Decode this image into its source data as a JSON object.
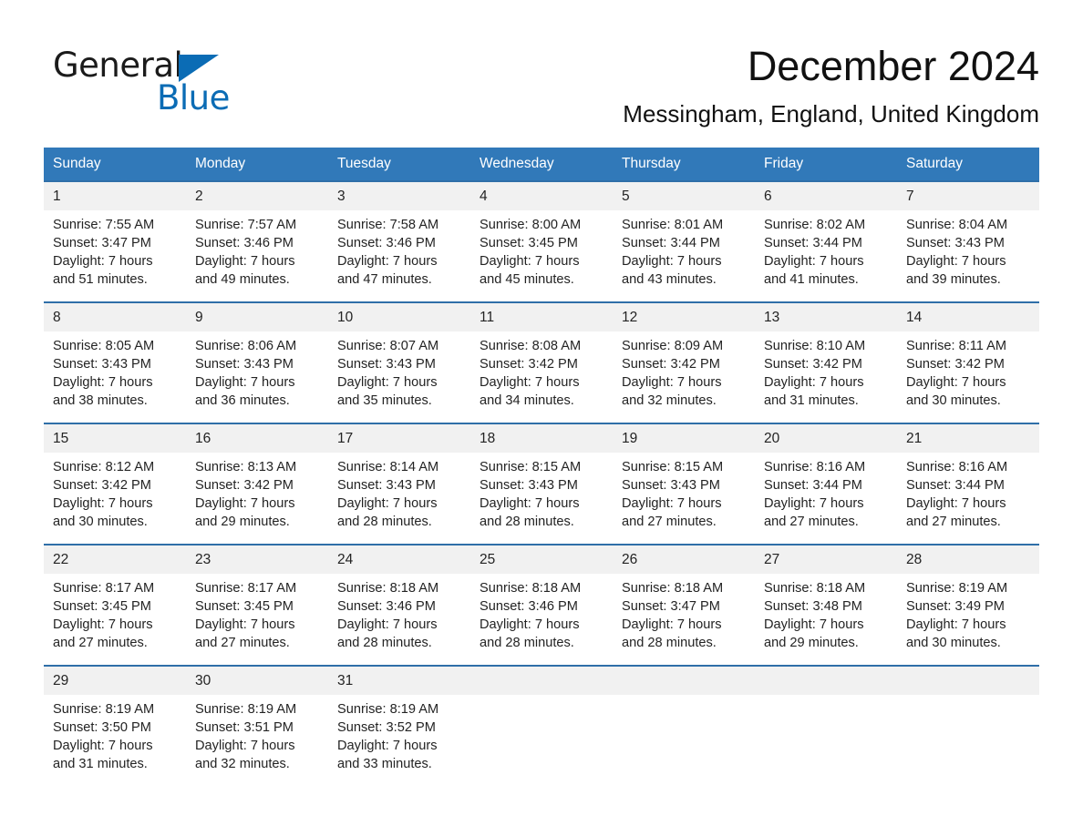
{
  "brand": {
    "name_part1": "General",
    "name_part2": "Blue",
    "triangle_color": "#0b6cb5"
  },
  "header": {
    "title": "December 2024",
    "subtitle": "Messingham, England, United Kingdom"
  },
  "theme": {
    "header_blue": "#3179b9",
    "row_divider_blue": "#2f6fa8",
    "daynum_band": "#f1f1f1",
    "text": "#232323"
  },
  "weekdays": [
    "Sunday",
    "Monday",
    "Tuesday",
    "Wednesday",
    "Thursday",
    "Friday",
    "Saturday"
  ],
  "weeks": [
    [
      {
        "day": "1",
        "l1": "Sunrise: 7:55 AM",
        "l2": "Sunset: 3:47 PM",
        "l3": "Daylight: 7 hours",
        "l4": "and 51 minutes."
      },
      {
        "day": "2",
        "l1": "Sunrise: 7:57 AM",
        "l2": "Sunset: 3:46 PM",
        "l3": "Daylight: 7 hours",
        "l4": "and 49 minutes."
      },
      {
        "day": "3",
        "l1": "Sunrise: 7:58 AM",
        "l2": "Sunset: 3:46 PM",
        "l3": "Daylight: 7 hours",
        "l4": "and 47 minutes."
      },
      {
        "day": "4",
        "l1": "Sunrise: 8:00 AM",
        "l2": "Sunset: 3:45 PM",
        "l3": "Daylight: 7 hours",
        "l4": "and 45 minutes."
      },
      {
        "day": "5",
        "l1": "Sunrise: 8:01 AM",
        "l2": "Sunset: 3:44 PM",
        "l3": "Daylight: 7 hours",
        "l4": "and 43 minutes."
      },
      {
        "day": "6",
        "l1": "Sunrise: 8:02 AM",
        "l2": "Sunset: 3:44 PM",
        "l3": "Daylight: 7 hours",
        "l4": "and 41 minutes."
      },
      {
        "day": "7",
        "l1": "Sunrise: 8:04 AM",
        "l2": "Sunset: 3:43 PM",
        "l3": "Daylight: 7 hours",
        "l4": "and 39 minutes."
      }
    ],
    [
      {
        "day": "8",
        "l1": "Sunrise: 8:05 AM",
        "l2": "Sunset: 3:43 PM",
        "l3": "Daylight: 7 hours",
        "l4": "and 38 minutes."
      },
      {
        "day": "9",
        "l1": "Sunrise: 8:06 AM",
        "l2": "Sunset: 3:43 PM",
        "l3": "Daylight: 7 hours",
        "l4": "and 36 minutes."
      },
      {
        "day": "10",
        "l1": "Sunrise: 8:07 AM",
        "l2": "Sunset: 3:43 PM",
        "l3": "Daylight: 7 hours",
        "l4": "and 35 minutes."
      },
      {
        "day": "11",
        "l1": "Sunrise: 8:08 AM",
        "l2": "Sunset: 3:42 PM",
        "l3": "Daylight: 7 hours",
        "l4": "and 34 minutes."
      },
      {
        "day": "12",
        "l1": "Sunrise: 8:09 AM",
        "l2": "Sunset: 3:42 PM",
        "l3": "Daylight: 7 hours",
        "l4": "and 32 minutes."
      },
      {
        "day": "13",
        "l1": "Sunrise: 8:10 AM",
        "l2": "Sunset: 3:42 PM",
        "l3": "Daylight: 7 hours",
        "l4": "and 31 minutes."
      },
      {
        "day": "14",
        "l1": "Sunrise: 8:11 AM",
        "l2": "Sunset: 3:42 PM",
        "l3": "Daylight: 7 hours",
        "l4": "and 30 minutes."
      }
    ],
    [
      {
        "day": "15",
        "l1": "Sunrise: 8:12 AM",
        "l2": "Sunset: 3:42 PM",
        "l3": "Daylight: 7 hours",
        "l4": "and 30 minutes."
      },
      {
        "day": "16",
        "l1": "Sunrise: 8:13 AM",
        "l2": "Sunset: 3:42 PM",
        "l3": "Daylight: 7 hours",
        "l4": "and 29 minutes."
      },
      {
        "day": "17",
        "l1": "Sunrise: 8:14 AM",
        "l2": "Sunset: 3:43 PM",
        "l3": "Daylight: 7 hours",
        "l4": "and 28 minutes."
      },
      {
        "day": "18",
        "l1": "Sunrise: 8:15 AM",
        "l2": "Sunset: 3:43 PM",
        "l3": "Daylight: 7 hours",
        "l4": "and 28 minutes."
      },
      {
        "day": "19",
        "l1": "Sunrise: 8:15 AM",
        "l2": "Sunset: 3:43 PM",
        "l3": "Daylight: 7 hours",
        "l4": "and 27 minutes."
      },
      {
        "day": "20",
        "l1": "Sunrise: 8:16 AM",
        "l2": "Sunset: 3:44 PM",
        "l3": "Daylight: 7 hours",
        "l4": "and 27 minutes."
      },
      {
        "day": "21",
        "l1": "Sunrise: 8:16 AM",
        "l2": "Sunset: 3:44 PM",
        "l3": "Daylight: 7 hours",
        "l4": "and 27 minutes."
      }
    ],
    [
      {
        "day": "22",
        "l1": "Sunrise: 8:17 AM",
        "l2": "Sunset: 3:45 PM",
        "l3": "Daylight: 7 hours",
        "l4": "and 27 minutes."
      },
      {
        "day": "23",
        "l1": "Sunrise: 8:17 AM",
        "l2": "Sunset: 3:45 PM",
        "l3": "Daylight: 7 hours",
        "l4": "and 27 minutes."
      },
      {
        "day": "24",
        "l1": "Sunrise: 8:18 AM",
        "l2": "Sunset: 3:46 PM",
        "l3": "Daylight: 7 hours",
        "l4": "and 28 minutes."
      },
      {
        "day": "25",
        "l1": "Sunrise: 8:18 AM",
        "l2": "Sunset: 3:46 PM",
        "l3": "Daylight: 7 hours",
        "l4": "and 28 minutes."
      },
      {
        "day": "26",
        "l1": "Sunrise: 8:18 AM",
        "l2": "Sunset: 3:47 PM",
        "l3": "Daylight: 7 hours",
        "l4": "and 28 minutes."
      },
      {
        "day": "27",
        "l1": "Sunrise: 8:18 AM",
        "l2": "Sunset: 3:48 PM",
        "l3": "Daylight: 7 hours",
        "l4": "and 29 minutes."
      },
      {
        "day": "28",
        "l1": "Sunrise: 8:19 AM",
        "l2": "Sunset: 3:49 PM",
        "l3": "Daylight: 7 hours",
        "l4": "and 30 minutes."
      }
    ],
    [
      {
        "day": "29",
        "l1": "Sunrise: 8:19 AM",
        "l2": "Sunset: 3:50 PM",
        "l3": "Daylight: 7 hours",
        "l4": "and 31 minutes."
      },
      {
        "day": "30",
        "l1": "Sunrise: 8:19 AM",
        "l2": "Sunset: 3:51 PM",
        "l3": "Daylight: 7 hours",
        "l4": "and 32 minutes."
      },
      {
        "day": "31",
        "l1": "Sunrise: 8:19 AM",
        "l2": "Sunset: 3:52 PM",
        "l3": "Daylight: 7 hours",
        "l4": "and 33 minutes."
      },
      {
        "day": "",
        "l1": "",
        "l2": "",
        "l3": "",
        "l4": ""
      },
      {
        "day": "",
        "l1": "",
        "l2": "",
        "l3": "",
        "l4": ""
      },
      {
        "day": "",
        "l1": "",
        "l2": "",
        "l3": "",
        "l4": ""
      },
      {
        "day": "",
        "l1": "",
        "l2": "",
        "l3": "",
        "l4": ""
      }
    ]
  ]
}
